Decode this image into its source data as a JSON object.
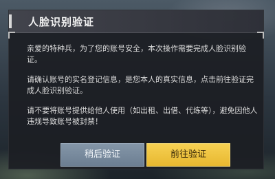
{
  "dialog": {
    "title": "人脸识别验证",
    "paragraphs": [
      "亲爱的特种兵，为了您的账号安全，本次操作需要完成人脸识别验证。",
      "请确认账号的实名登记信息，是您本人的真实信息，点击前往验证完成人脸识别验证。",
      "请不要将账号提供给他人使用（如出租、出借、代练等），避免因他人违规导致账号被封禁！"
    ],
    "buttons": {
      "later_label": "稍后验证",
      "go_label": "前往验证"
    }
  }
}
